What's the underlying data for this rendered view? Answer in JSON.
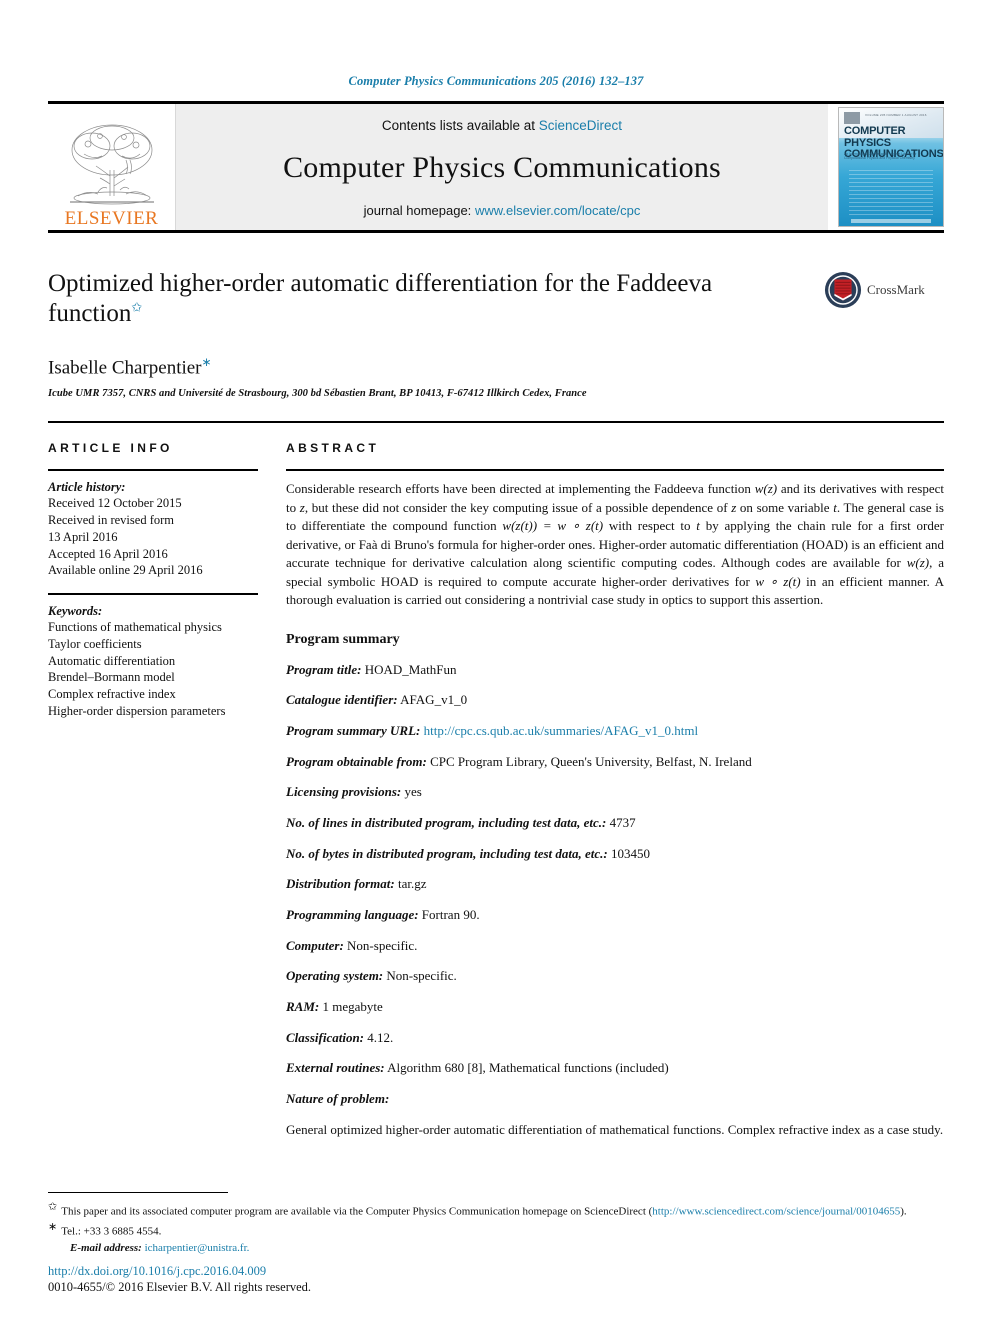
{
  "running_head": "Computer Physics Communications 205 (2016) 132–137",
  "masthead": {
    "contents_prefix": "Contents lists available at",
    "sciencedirect": "ScienceDirect",
    "journal_title": "Computer Physics Communications",
    "homepage_prefix": "journal homepage:",
    "homepage_url": "www.elsevier.com/locate/cpc",
    "publisher": "ELSEVIER",
    "cover": {
      "title_line1": "COMPUTER PHYSICS",
      "title_line2": "COMMUNICATIONS",
      "issue_line": "VOLUME 205    NUMBER 1    AUGUST 2016",
      "subtitle": "An International Journal and Program Library for Computational Physics and Physical Chemistry"
    }
  },
  "article": {
    "title": "Optimized higher-order automatic differentiation for the Faddeeva function",
    "title_footnote_mark": "✩",
    "author": "Isabelle Charpentier",
    "author_footnote_mark": "∗",
    "affiliation": "Icube UMR 7357, CNRS and Université de Strasbourg, 300 bd Sébastien Brant, BP 10413, F-67412 Illkirch Cedex, France",
    "crossmark_label": "CrossMark"
  },
  "article_info": {
    "heading": "ARTICLE INFO",
    "history_label": "Article history:",
    "history": [
      "Received 12 October 2015",
      "Received in revised form",
      "13 April 2016",
      "Accepted 16 April 2016",
      "Available online 29 April 2016"
    ],
    "keywords_label": "Keywords:",
    "keywords": [
      "Functions of mathematical physics",
      "Taylor coefficients",
      "Automatic differentiation",
      "Brendel–Bormann model",
      "Complex refractive index",
      "Higher-order dispersion parameters"
    ]
  },
  "abstract": {
    "heading": "ABSTRACT",
    "p1_a": "Considerable research efforts have been directed at implementing the Faddeeva function ",
    "p1_w_z": "w(z)",
    "p1_b": " and its derivatives with respect to ",
    "p1_z": "z",
    "p1_c": ", but these did not consider the key computing issue of a possible dependence of ",
    "p1_z2": "z",
    "p1_d": " on some variable ",
    "p1_t": "t",
    "p1_e": ". The general case is to differentiate the compound function ",
    "p1_eq": "w(z(t)) = w ∘ z(t)",
    "p1_f": " with respect to ",
    "p1_t2": "t",
    "p1_g": " by applying the chain rule for a first order derivative, or Faà di Bruno's formula for higher-order ones. Higher-order automatic differentiation (HOAD) is an efficient and accurate technique for derivative calculation along scientific computing codes. Although codes are available for ",
    "p1_w_z2": "w(z)",
    "p1_h": ", a special symbolic HOAD is required to compute accurate higher-order derivatives for ",
    "p1_eq2": "w ∘ z(t)",
    "p1_i": " in an efficient manner. A thorough evaluation is carried out considering a nontrivial case study in optics to support this assertion."
  },
  "program_summary": {
    "heading": "Program summary",
    "rows": [
      {
        "key": "Program title:",
        "value": "HOAD_MathFun",
        "is_link": false
      },
      {
        "key": "Catalogue identifier:",
        "value": "AFAG_v1_0",
        "is_link": false
      },
      {
        "key": "Program summary URL:",
        "value": "http://cpc.cs.qub.ac.uk/summaries/AFAG_v1_0.html",
        "is_link": true
      },
      {
        "key": "Program obtainable from:",
        "value": "CPC Program Library, Queen's University, Belfast, N. Ireland",
        "is_link": false
      },
      {
        "key": "Licensing provisions:",
        "value": "yes",
        "is_link": false
      },
      {
        "key": "No. of lines in distributed program, including test data, etc.:",
        "value": "4737",
        "is_link": false
      },
      {
        "key": "No. of bytes in distributed program, including test data, etc.:",
        "value": "103450",
        "is_link": false
      },
      {
        "key": "Distribution format:",
        "value": "tar.gz",
        "is_link": false
      },
      {
        "key": "Programming language:",
        "value": "Fortran 90.",
        "is_link": false
      },
      {
        "key": "Computer:",
        "value": "Non-specific.",
        "is_link": false
      },
      {
        "key": "Operating system:",
        "value": "Non-specific.",
        "is_link": false
      },
      {
        "key": "RAM:",
        "value": "1 megabyte",
        "is_link": false
      },
      {
        "key": "Classification:",
        "value": "4.12.",
        "is_link": false
      },
      {
        "key": "External routines:",
        "value": "Algorithm 680 [8], Mathematical functions (included)",
        "is_link": false
      },
      {
        "key": "Nature of problem:",
        "value": "",
        "is_link": false
      }
    ],
    "nature_text": "General optimized higher-order automatic differentiation of mathematical functions. Complex refractive index as a case study."
  },
  "footnotes": {
    "star_mark": "✩",
    "star_text": "This paper and its associated computer program are available via the Computer Physics Communication homepage on ScienceDirect",
    "star_paren_open": "(",
    "star_url": "http://www.sciencedirect.com/science/journal/00104655",
    "star_paren_close": ").",
    "tel_mark": "∗",
    "tel_text": "Tel.: +33 3 6885 4554.",
    "email_label": "E-mail address:",
    "email": "icharpentier@unistra.fr.",
    "doi": "http://dx.doi.org/10.1016/j.cpc.2016.04.009",
    "copyright": "0010-4655/© 2016 Elsevier B.V. All rights reserved."
  },
  "colors": {
    "link": "#1a7eaa",
    "elsevier_orange": "#e87722",
    "masthead_bg": "#eeeeee",
    "cover_blue": "#36a7d6",
    "crossmark_red": "#c32026",
    "crossmark_navy": "#2b3e58"
  }
}
